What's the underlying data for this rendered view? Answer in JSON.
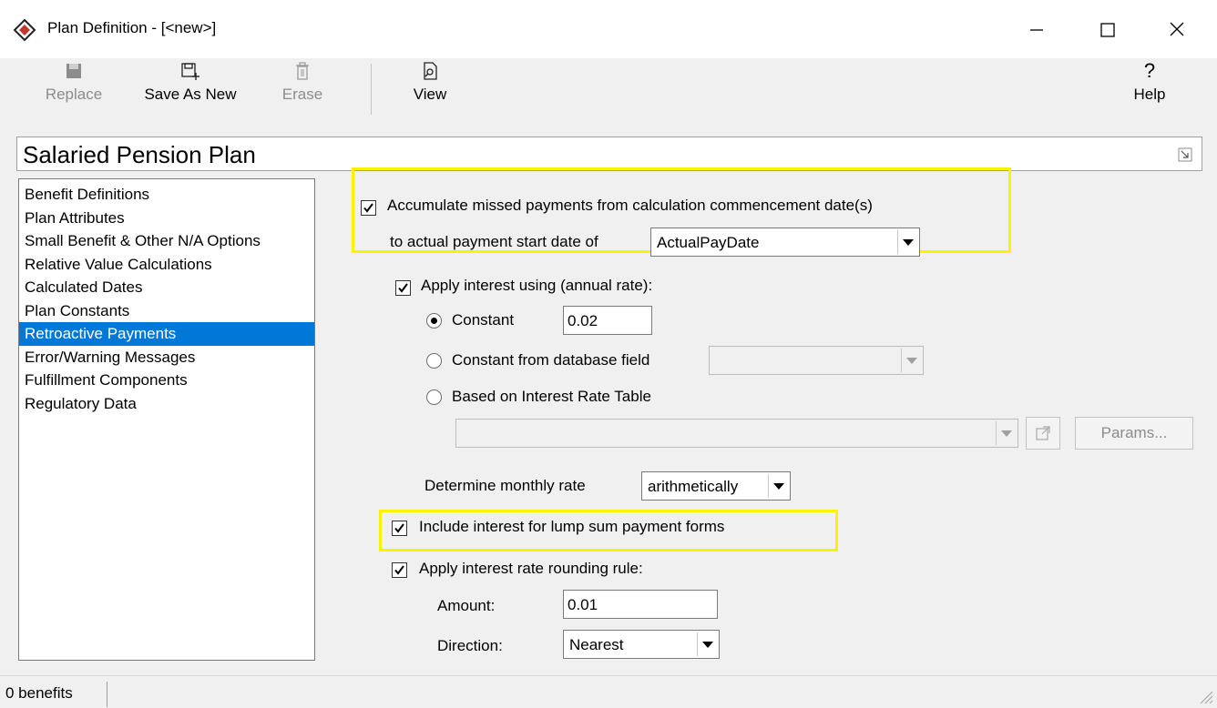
{
  "window": {
    "title": "Plan Definition - [<new>]",
    "icons": {
      "app": "app-logo-icon",
      "minimize": "minimize-icon",
      "maximize": "maximize-icon",
      "close": "close-icon"
    }
  },
  "toolbar": {
    "replace_label": "Replace",
    "save_as_new_label": "Save As New",
    "erase_label": "Erase",
    "view_label": "View",
    "help_label": "Help",
    "help_glyph": "?"
  },
  "header": {
    "plan_name": "Salaried Pension Plan"
  },
  "nav": {
    "items": [
      "Benefit Definitions",
      "Plan Attributes",
      "Small Benefit & Other N/A Options",
      "Relative Value Calculations",
      "Calculated Dates",
      "Plan Constants",
      "Retroactive Payments",
      "Error/Warning Messages",
      "Fulfillment Components",
      "Regulatory Data"
    ],
    "selected_index": 6
  },
  "form": {
    "accumulate_label": "Accumulate missed payments from calculation commencement date(s)",
    "accumulate_checked": true,
    "to_actual_label": "to actual payment start date of",
    "start_date_value": "ActualPayDate",
    "apply_interest_label": "Apply interest using (annual rate):",
    "apply_interest_checked": true,
    "constant_label": "Constant",
    "constant_value": "0.02",
    "constant_db_label": "Constant from database field",
    "constant_db_value": "",
    "rate_table_label": "Based on Interest Rate Table",
    "rate_table_value": "",
    "params_label": "Params...",
    "monthly_rate_label": "Determine monthly rate",
    "monthly_rate_value": "arithmetically",
    "lump_sum_label": "Include interest for lump sum payment forms",
    "lump_sum_checked": true,
    "rounding_label": "Apply interest rate rounding rule:",
    "rounding_checked": true,
    "amount_label": "Amount:",
    "amount_value": "0.01",
    "direction_label": "Direction:",
    "direction_value": "Nearest"
  },
  "status": {
    "benefits_count": "0 benefits"
  },
  "colors": {
    "selection": "#0078d7",
    "highlight": "#fff200"
  }
}
